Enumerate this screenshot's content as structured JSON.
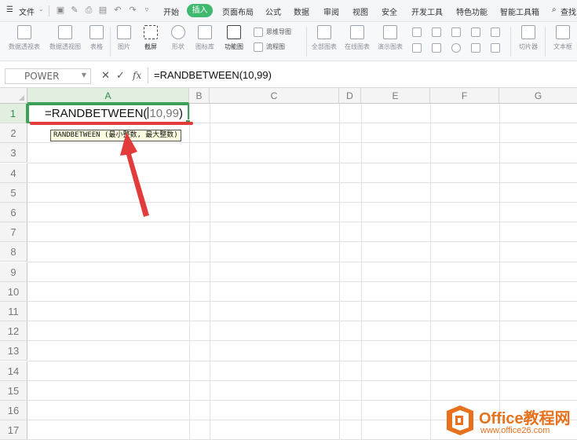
{
  "menubar": {
    "file_label": "文件",
    "tabs": [
      "开始",
      "插入",
      "页面布局",
      "公式",
      "数据",
      "审阅",
      "视图",
      "安全",
      "开发工具",
      "特色功能",
      "智能工具箱"
    ],
    "active_tab": "插入",
    "search_label": "查找"
  },
  "ribbon": {
    "buttons": [
      "数据透视表",
      "数据透视图",
      "表格",
      "图片",
      "截屏",
      "形状",
      "图标库",
      "功能图",
      "全部图表",
      "在线图表",
      "演示图表",
      "切片器",
      "文本框"
    ],
    "mind_map": "思维导图",
    "flow_chart": "流程图"
  },
  "formula_bar": {
    "name_box": "POWER",
    "fx_label": "fx",
    "formula": "=RANDBETWEEN(10,99)"
  },
  "grid": {
    "columns": [
      "A",
      "B",
      "C",
      "D",
      "E",
      "F",
      "G"
    ],
    "rows": [
      "1",
      "2",
      "3",
      "4",
      "5",
      "6",
      "7",
      "8",
      "9",
      "10",
      "11",
      "12",
      "13",
      "14",
      "15",
      "16",
      "17"
    ]
  },
  "cell": {
    "prefix": "=RANDBETWEEN(",
    "args": "10,99",
    "suffix": ")"
  },
  "tooltip": "RANDBETWEEN (最小整数, 最大整数)",
  "watermark": {
    "title": "Office教程网",
    "url": "www.office26.com"
  },
  "colors": {
    "accent": "#3fb96d",
    "selection": "#3e9f57",
    "arrow": "#e23b3b",
    "watermark": "#e8711e"
  }
}
